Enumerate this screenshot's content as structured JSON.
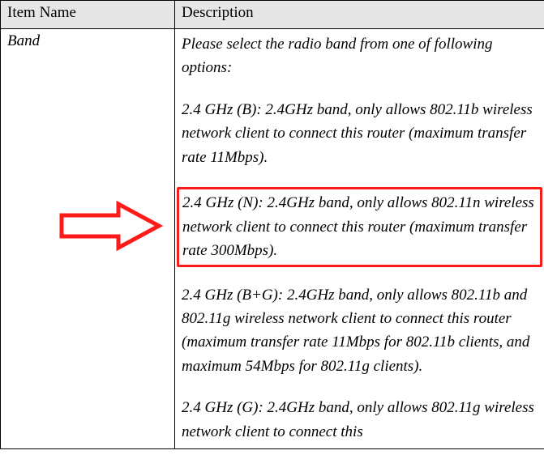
{
  "headers": {
    "item_name": "Item Name",
    "description": "Description"
  },
  "row": {
    "item": "Band",
    "intro": "Please select the radio band from one of following options:",
    "opt_b": "2.4 GHz (B): 2.4GHz band, only allows 802.11b wireless network client to connect this router (maximum transfer rate 11Mbps).",
    "opt_n": "2.4 GHz (N): 2.4GHz band, only allows 802.11n wireless network client to connect this router (maximum transfer rate 300Mbps).",
    "opt_bg": "2.4 GHz (B+G): 2.4GHz band, only allows 802.11b and 802.11g wireless network client to connect this router (maximum transfer rate 11Mbps for 802.11b clients, and maximum 54Mbps for 802.11g clients).",
    "opt_g": "2.4 GHz (G): 2.4GHz band, only allows 802.11g wireless network client to connect this"
  }
}
